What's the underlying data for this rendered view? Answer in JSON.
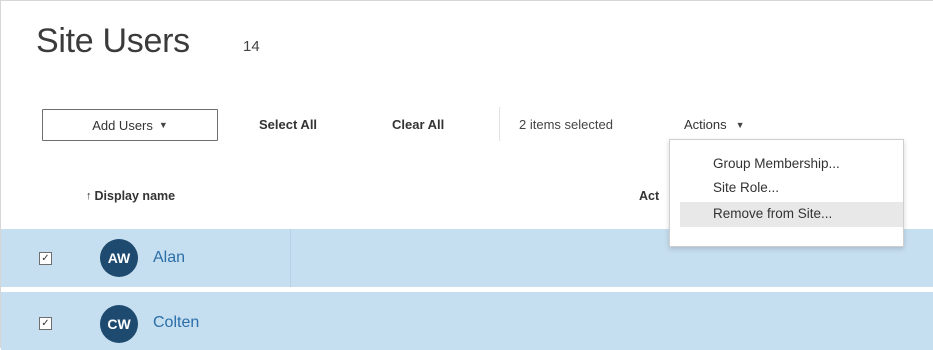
{
  "page": {
    "title": "Site Users",
    "count": "14"
  },
  "toolbar": {
    "add_users_label": "Add Users",
    "select_all_label": "Select All",
    "clear_all_label": "Clear All",
    "selected_text": "2 items selected",
    "actions_label": "Actions"
  },
  "columns": {
    "display_name": "Display name",
    "second_partial": "Act"
  },
  "actions_menu": {
    "items": [
      "Group Membership...",
      "Site Role...",
      "Remove from Site..."
    ],
    "highlighted_index": 2
  },
  "users": [
    {
      "initials": "AW",
      "name": "Alan",
      "selected": true
    },
    {
      "initials": "CW",
      "name": "Colten",
      "selected": true
    }
  ],
  "icons": {
    "add_users_caret": "caret-down-icon",
    "actions_caret": "caret-down-icon",
    "sort": "sort-ascending-icon",
    "checkbox_checked": "checkbox-checked-icon"
  },
  "colors": {
    "selected_row_bg": "#c6dff0",
    "avatar_bg": "#1e4a70",
    "link_blue": "#2a6ea8"
  }
}
